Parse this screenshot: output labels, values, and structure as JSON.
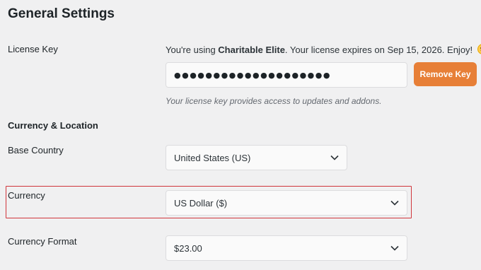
{
  "page": {
    "title": "General Settings"
  },
  "license": {
    "label": "License Key",
    "info_prefix": "You're using ",
    "plan_name": "Charitable Elite",
    "info_suffix": ". Your license expires on Sep 15, 2026. Enjoy!",
    "key_value": "●●●●●●●●●●●●●●●●●●●●",
    "remove_button_label": "Remove Key",
    "help_text": "Your license key provides access to updates and addons.",
    "emoji_icon": "slightly-smiling-face-icon"
  },
  "currency_section": {
    "heading": "Currency & Location",
    "base_country_label": "Base Country",
    "base_country_value": "United States (US)",
    "currency_label": "Currency",
    "currency_value": "US Dollar ($)",
    "currency_format_label": "Currency Format",
    "currency_format_value": "$23.00"
  },
  "colors": {
    "accent_button": "#e77f37",
    "highlight_border": "#d0353b",
    "background": "#f0f0f1"
  }
}
